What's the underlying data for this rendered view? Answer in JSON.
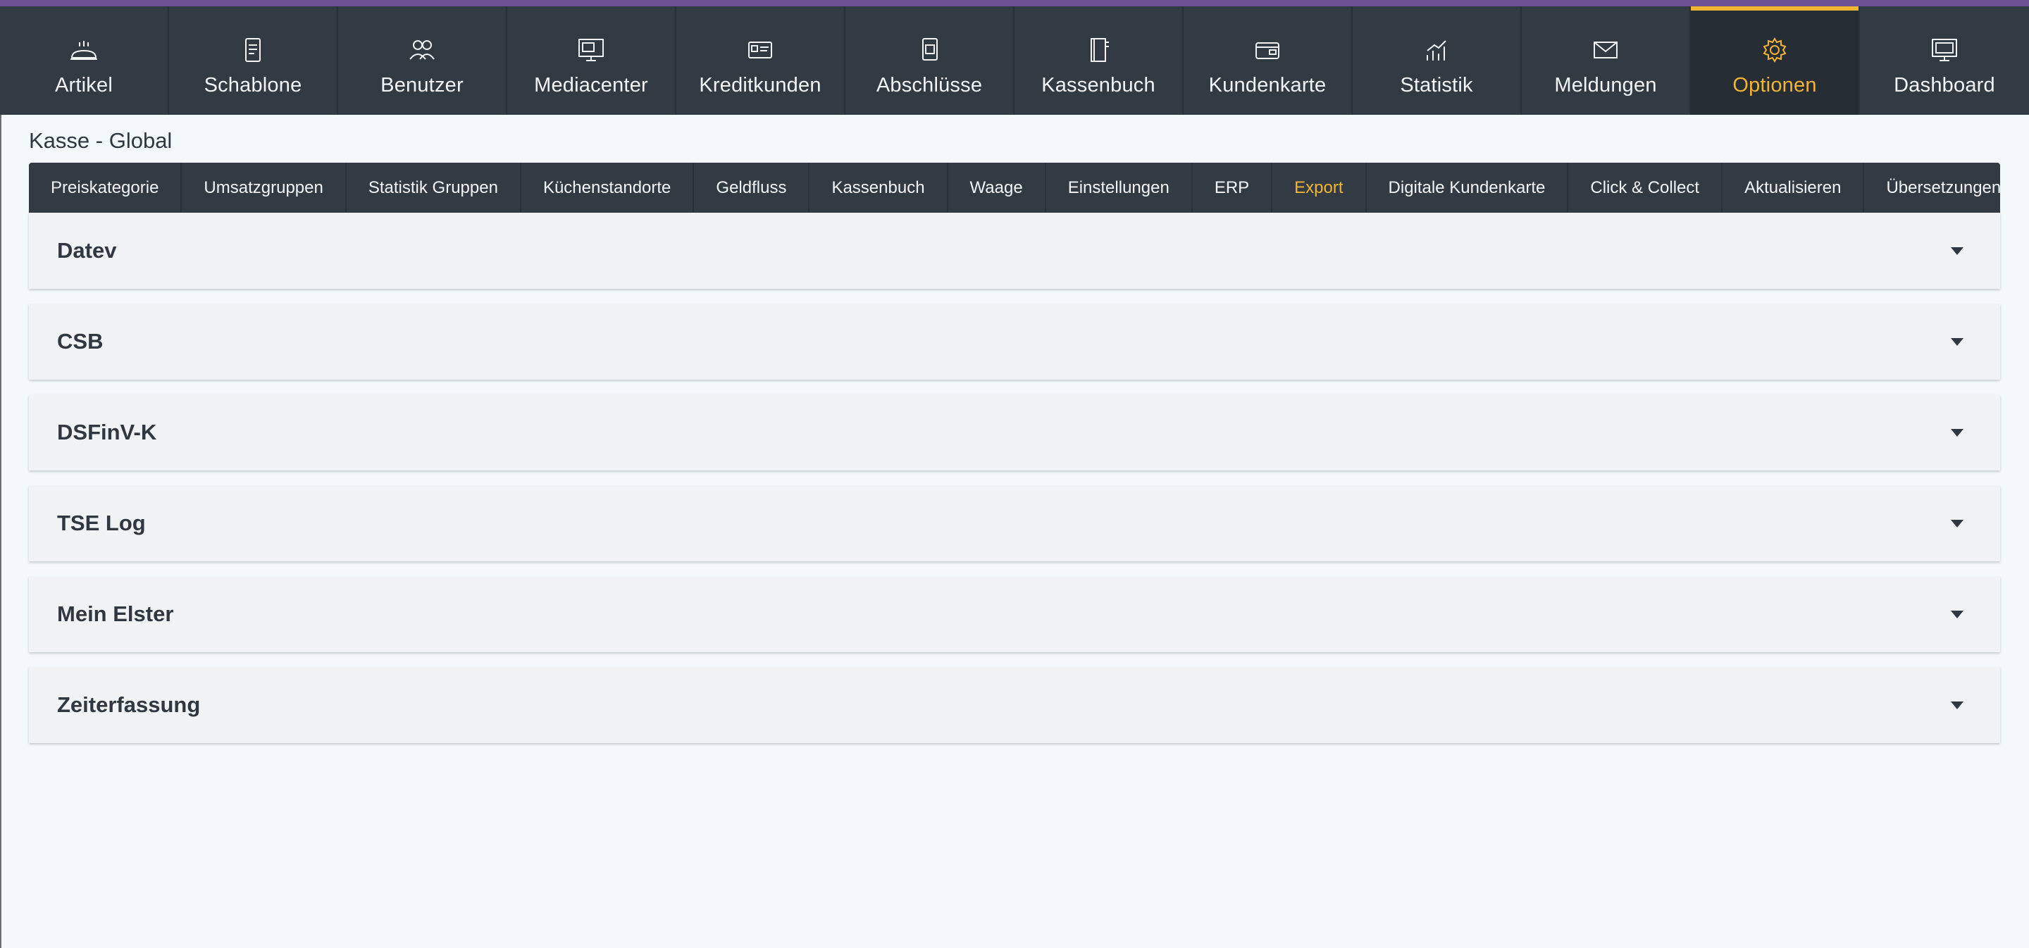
{
  "topnav": {
    "items": [
      {
        "label": "Artikel",
        "icon": "bread-icon"
      },
      {
        "label": "Schablone",
        "icon": "template-icon"
      },
      {
        "label": "Benutzer",
        "icon": "users-icon"
      },
      {
        "label": "Mediacenter",
        "icon": "monitor-icon"
      },
      {
        "label": "Kreditkunden",
        "icon": "id-card-icon"
      },
      {
        "label": "Abschlüsse",
        "icon": "documents-icon"
      },
      {
        "label": "Kassenbuch",
        "icon": "cashbook-icon"
      },
      {
        "label": "Kundenkarte",
        "icon": "wallet-icon"
      },
      {
        "label": "Statistik",
        "icon": "chart-icon"
      },
      {
        "label": "Meldungen",
        "icon": "envelope-icon"
      },
      {
        "label": "Optionen",
        "icon": "gear-icon",
        "active": true
      },
      {
        "label": "Dashboard",
        "icon": "dashboard-icon"
      }
    ]
  },
  "page": {
    "title": "Kasse - Global"
  },
  "subnav": {
    "items": [
      {
        "label": "Preiskategorie"
      },
      {
        "label": "Umsatzgruppen"
      },
      {
        "label": "Statistik Gruppen"
      },
      {
        "label": "Küchenstandorte"
      },
      {
        "label": "Geldfluss"
      },
      {
        "label": "Kassenbuch"
      },
      {
        "label": "Waage"
      },
      {
        "label": "Einstellungen"
      },
      {
        "label": "ERP"
      },
      {
        "label": "Export",
        "active": true
      },
      {
        "label": "Digitale Kundenkarte"
      },
      {
        "label": "Click & Collect"
      },
      {
        "label": "Aktualisieren"
      },
      {
        "label": "Übersetzungen"
      }
    ]
  },
  "panels": [
    {
      "title": "Datev"
    },
    {
      "title": "CSB"
    },
    {
      "title": "DSFinV-K"
    },
    {
      "title": "TSE Log"
    },
    {
      "title": "Mein Elster"
    },
    {
      "title": "Zeiterfassung"
    }
  ],
  "colors": {
    "accent": "#f2b533",
    "topbar": "#323b44",
    "top_stripe": "#6c4f8f",
    "background": "#f3f9fa"
  }
}
